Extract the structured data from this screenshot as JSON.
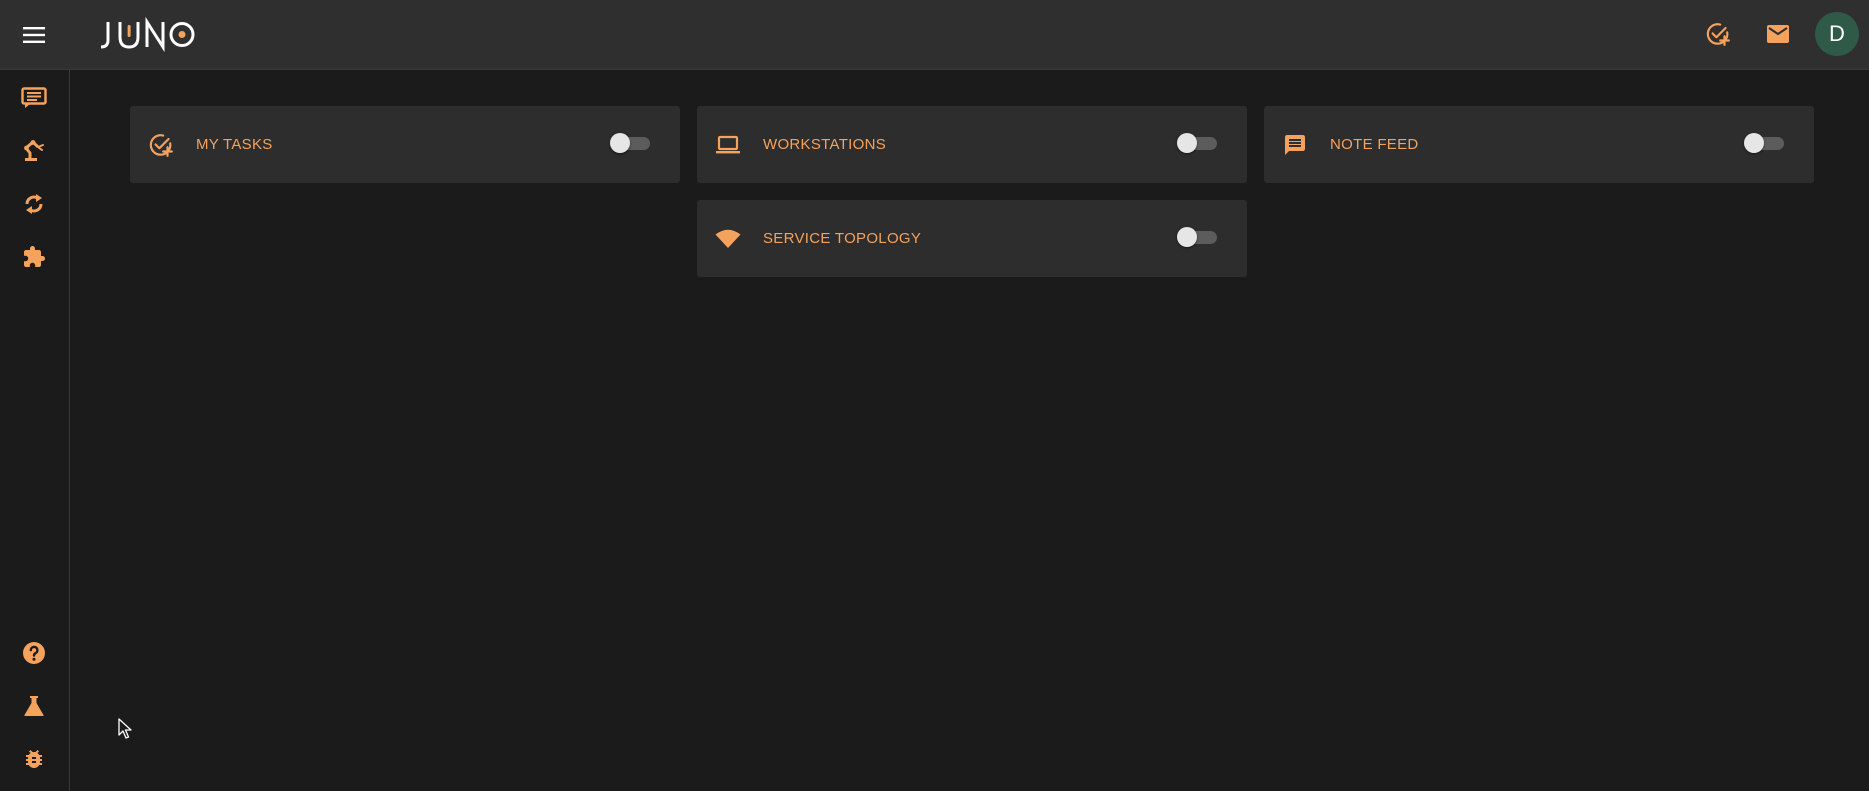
{
  "app": {
    "logo_text": "JUNO"
  },
  "colors": {
    "accent": "#f5a25d",
    "topbar_bg": "#2f2f2f",
    "page_bg": "#1b1b1b",
    "card_bg": "#2d2d2d",
    "avatar_bg": "#2f5a47"
  },
  "header": {
    "menu_icon": "hamburger-menu-icon",
    "actions": [
      {
        "icon": "task-add-icon"
      },
      {
        "icon": "mail-icon"
      }
    ],
    "avatar_initial": "D"
  },
  "sidebar": {
    "top_items": [
      {
        "icon": "message-list-icon"
      },
      {
        "icon": "robot-arm-icon"
      },
      {
        "icon": "sync-icon"
      },
      {
        "icon": "puzzle-icon"
      }
    ],
    "bottom_items": [
      {
        "icon": "help-icon"
      },
      {
        "icon": "flask-icon"
      },
      {
        "icon": "bug-icon"
      }
    ]
  },
  "widgets": [
    {
      "label": "MY TASKS",
      "icon": "task-add-icon",
      "enabled": false
    },
    {
      "label": "WORKSTATIONS",
      "icon": "laptop-icon",
      "enabled": false
    },
    {
      "label": "NOTE FEED",
      "icon": "chat-note-icon",
      "enabled": false
    },
    {
      "label": "SERVICE TOPOLOGY",
      "icon": "wifi-icon",
      "enabled": false
    }
  ]
}
